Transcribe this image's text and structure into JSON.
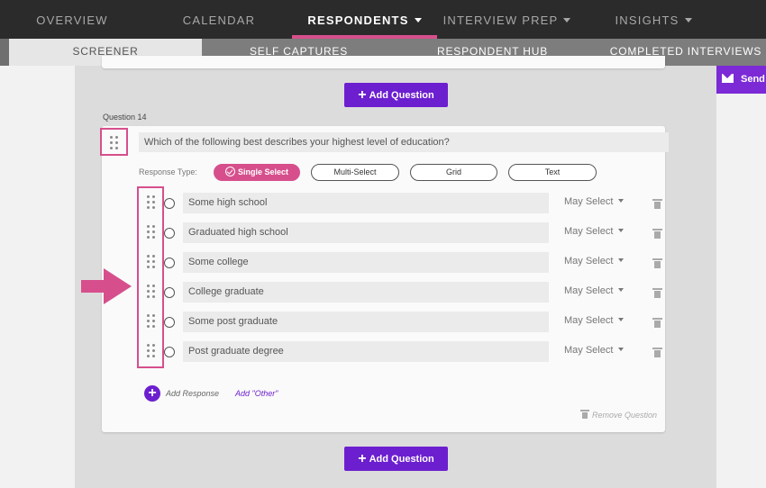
{
  "topnav": {
    "items": [
      {
        "label": "OVERVIEW",
        "caret": false
      },
      {
        "label": "CALENDAR",
        "caret": false
      },
      {
        "label": "RESPONDENTS",
        "caret": true,
        "active": true
      },
      {
        "label": "INTERVIEW PREP",
        "caret": true
      },
      {
        "label": "INSIGHTS",
        "caret": true
      }
    ]
  },
  "subnav": {
    "items": [
      {
        "label": "SCREENER",
        "active": true
      },
      {
        "label": "SELF CAPTURES"
      },
      {
        "label": "RESPONDENT HUB"
      },
      {
        "label": "COMPLETED INTERVIEWS"
      }
    ]
  },
  "send_label": "Send",
  "add_question_label": "Add Question",
  "question": {
    "number_label": "Question 14",
    "text": "Which of the following best describes your highest level of education?",
    "response_type_label": "Response Type:",
    "types": [
      "Single Select",
      "Multi-Select",
      "Grid",
      "Text"
    ],
    "selected_type": "Single Select",
    "responses": [
      {
        "text": "Some high school",
        "select": "May Select"
      },
      {
        "text": "Graduated high school",
        "select": "May Select"
      },
      {
        "text": "Some college",
        "select": "May Select"
      },
      {
        "text": "College graduate",
        "select": "May Select"
      },
      {
        "text": "Some post graduate",
        "select": "May Select"
      },
      {
        "text": "Post graduate degree",
        "select": "May Select"
      }
    ],
    "add_response_label": "Add Response",
    "add_other_label": "Add \"Other\"",
    "remove_question_label": "Remove Question"
  },
  "colors": {
    "accent_purple": "#6c1fcf",
    "highlight_pink": "#d64f8c",
    "nav_dark": "#2b2b2b"
  }
}
